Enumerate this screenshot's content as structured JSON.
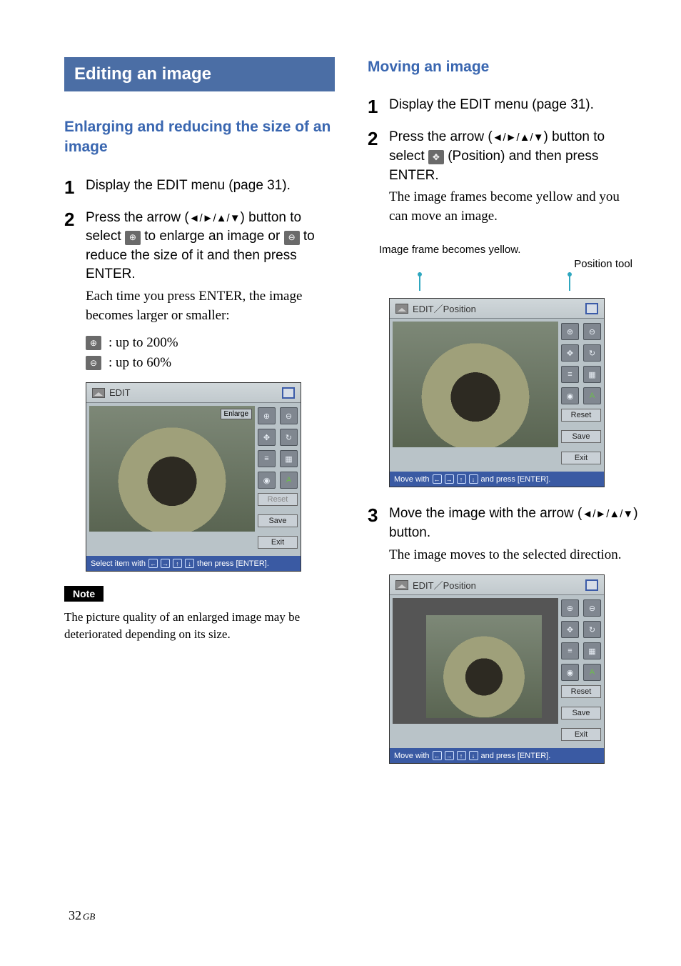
{
  "left": {
    "banner": "Editing an image",
    "subheading": "Enlarging and reducing the size of an image",
    "step1": "Display the EDIT menu (page 31).",
    "step2_a": "Press the arrow (",
    "step2_b": ") button to select ",
    "step2_c": " to enlarge an image or ",
    "step2_d": " to reduce the size of it and then press ENTER.",
    "step2_expl": "Each time you press ENTER, the image becomes larger or smaller:",
    "zoom_enlarge": ":  up to 200%",
    "zoom_reduce": ":  up to 60%",
    "noteLabel": "Note",
    "noteText": "The picture quality of an enlarged image may be deteriorated depending on its size."
  },
  "right": {
    "subheading": "Moving an image",
    "step1": "Display the EDIT menu (page 31).",
    "step2_a": "Press the arrow (",
    "step2_b": ") button to select ",
    "step2_c": " (Position) and then press ENTER.",
    "step2_expl": "The image frames become yellow and you can move an image.",
    "callout_frame": "Image frame becomes yellow.",
    "callout_tool": "Position tool",
    "step3_a": "Move the image with the arrow (",
    "step3_b": ") button.",
    "step3_expl": "The image moves to the selected direction."
  },
  "arrows": "◄/►/▲/▼",
  "ui": {
    "editTitle": "EDIT",
    "editPosTitle": "EDIT／Position",
    "enlargeChip": "Enlarge",
    "reset": "Reset",
    "save": "Save",
    "exit": "Exit",
    "status_select_a": "Select item with",
    "status_select_b": "then press [ENTER].",
    "status_move_a": "Move with",
    "status_move_b": "and press [ENTER]."
  },
  "icons": {
    "zoomIn": "⊕",
    "zoomOut": "⊖",
    "position": "✥",
    "rotate": "↻",
    "adjust": "≡",
    "filter": "▦",
    "redeye": "◉",
    "text": "A",
    "frame": "▭"
  },
  "page": {
    "number": "32",
    "region": "GB"
  }
}
